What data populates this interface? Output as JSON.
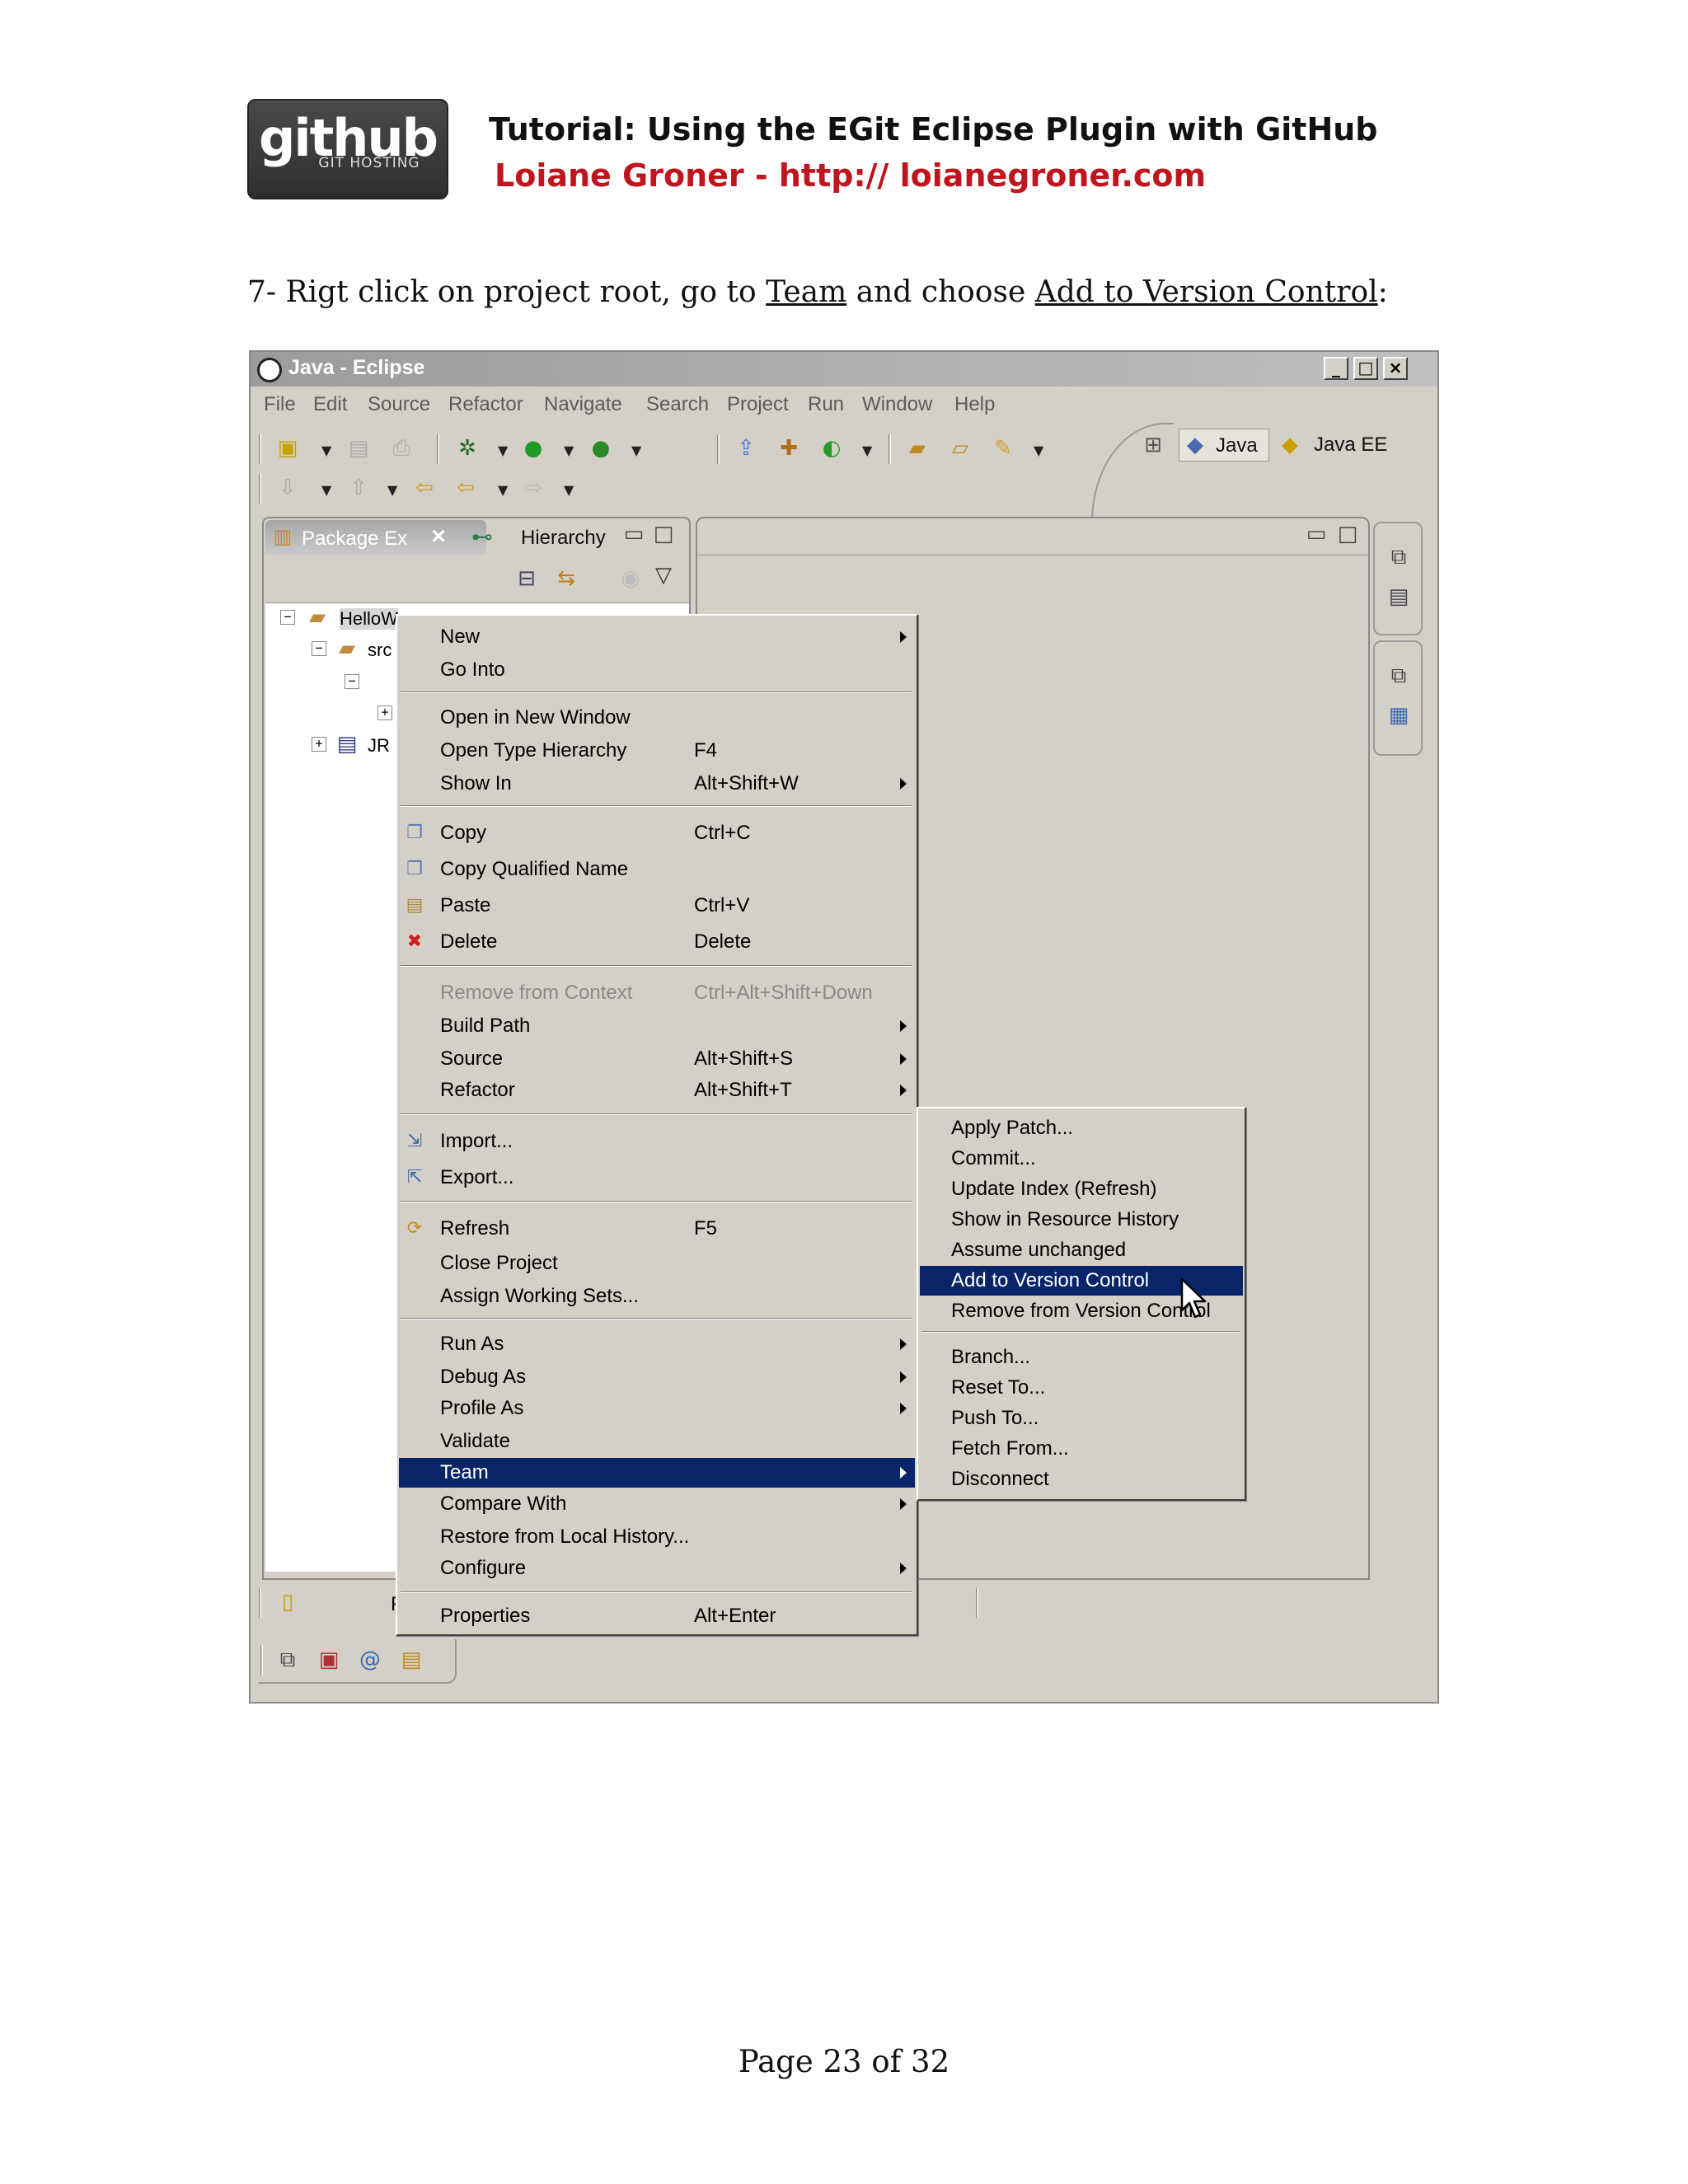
{
  "header": {
    "logo_word": "github",
    "logo_sub": "GIT HOSTING",
    "title": "Tutorial: Using the EGit Eclipse Plugin with GitHub",
    "author": "Loiane Groner - http:// loianegroner.com"
  },
  "instruction": {
    "prefix": "7- Rigt click on project root, go to ",
    "team": "Team",
    "middle": " and choose ",
    "action": "Add to Version Control",
    "suffix": ":"
  },
  "window": {
    "title": "Java - Eclipse",
    "min": "_",
    "max": "□",
    "close": "×"
  },
  "menubar": [
    "File",
    "Edit",
    "Source",
    "Refactor",
    "Navigate",
    "Search",
    "Project",
    "Run",
    "Window",
    "Help"
  ],
  "perspectives": {
    "java": "Java",
    "javaee": "Java EE"
  },
  "package_view": {
    "tab_label": "Package Ex",
    "close": "✕",
    "hierarchy_label": "Hierarchy",
    "tree": {
      "project": "HelloW",
      "src": "src",
      "jre": "JR"
    },
    "bottom_label": "F"
  },
  "context_menu": [
    {
      "label": "New",
      "accel": "",
      "submenu": true
    },
    {
      "label": "Go Into",
      "accel": ""
    },
    {
      "label": "Open in New Window",
      "accel": ""
    },
    {
      "label": "Open Type Hierarchy",
      "accel": "F4"
    },
    {
      "label": "Show In",
      "accel": "Alt+Shift+W",
      "submenu": true
    },
    {
      "label": "Copy",
      "accel": "Ctrl+C"
    },
    {
      "label": "Copy Qualified Name",
      "accel": ""
    },
    {
      "label": "Paste",
      "accel": "Ctrl+V"
    },
    {
      "label": "Delete",
      "accel": "Delete"
    },
    {
      "label": "Remove from Context",
      "accel": "Ctrl+Alt+Shift+Down",
      "disabled": true
    },
    {
      "label": "Build Path",
      "accel": "",
      "submenu": true
    },
    {
      "label": "Source",
      "accel": "Alt+Shift+S",
      "submenu": true
    },
    {
      "label": "Refactor",
      "accel": "Alt+Shift+T",
      "submenu": true
    },
    {
      "label": "Import...",
      "accel": ""
    },
    {
      "label": "Export...",
      "accel": ""
    },
    {
      "label": "Refresh",
      "accel": "F5"
    },
    {
      "label": "Close Project",
      "accel": ""
    },
    {
      "label": "Assign Working Sets...",
      "accel": ""
    },
    {
      "label": "Run As",
      "accel": "",
      "submenu": true
    },
    {
      "label": "Debug As",
      "accel": "",
      "submenu": true
    },
    {
      "label": "Profile As",
      "accel": "",
      "submenu": true
    },
    {
      "label": "Validate",
      "accel": ""
    },
    {
      "label": "Team",
      "accel": "",
      "submenu": true,
      "selected": true
    },
    {
      "label": "Compare With",
      "accel": "",
      "submenu": true
    },
    {
      "label": "Restore from Local History...",
      "accel": ""
    },
    {
      "label": "Configure",
      "accel": "",
      "submenu": true
    },
    {
      "label": "Properties",
      "accel": "Alt+Enter"
    }
  ],
  "team_submenu": [
    {
      "label": "Apply Patch..."
    },
    {
      "label": "Commit..."
    },
    {
      "label": "Update Index (Refresh)"
    },
    {
      "label": "Show in Resource History"
    },
    {
      "label": "Assume unchanged"
    },
    {
      "label": "Add to Version Control",
      "selected": true
    },
    {
      "label": "Remove from Version Control"
    },
    {
      "label": "Branch..."
    },
    {
      "label": "Reset To..."
    },
    {
      "label": "Push To..."
    },
    {
      "label": "Fetch From..."
    },
    {
      "label": "Disconnect"
    }
  ],
  "page": "Page 23 of 32"
}
